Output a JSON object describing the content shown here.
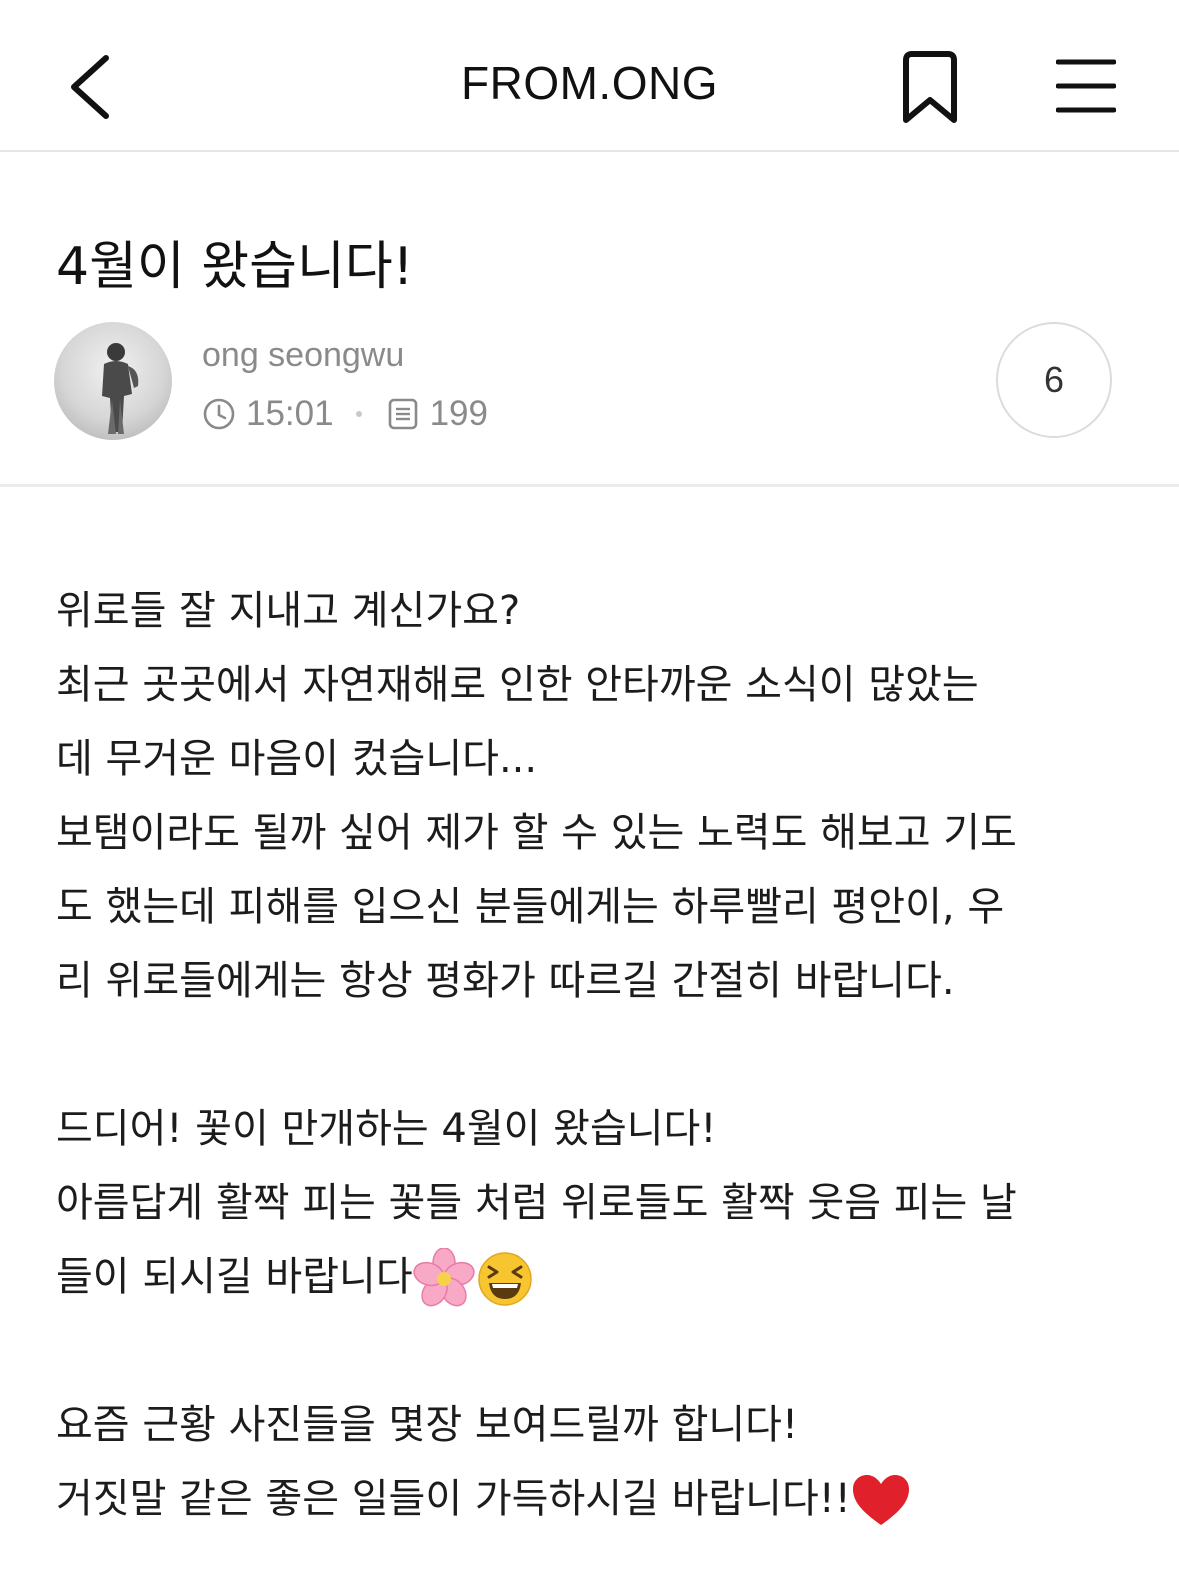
{
  "header": {
    "title": "FROM.ONG",
    "back_icon": "chevron-left-icon",
    "bookmark_icon": "bookmark-icon",
    "menu_icon": "hamburger-menu-icon"
  },
  "post": {
    "title": "4월이 왔습니다!",
    "author": "ong seongwu",
    "time": "15:01",
    "views": "199",
    "comment_count": "6"
  },
  "body": {
    "p1": [
      "위로들 잘 지내고 계신가요?",
      "최근 곳곳에서 자연재해로 인한 안타까운 소식이 많았는",
      "데 무거운 마음이 컸습니다...",
      "보탬이라도 될까 싶어 제가 할 수 있는 노력도 해보고 기도",
      "도 했는데 피해를 입으신 분들에게는 하루빨리 평안이, 우",
      "리 위로들에게는 항상 평화가 따르길 간절히 바랍니다."
    ],
    "p2": [
      "드디어! 꽃이 만개하는 4월이 왔습니다!",
      "아름답게 활짝 피는 꽃들 처럼 위로들도 활짝 웃음 피는 날",
      "들이 되시길 바랍니다"
    ],
    "p3": [
      "요즘 근황 사진들을 몇장 보여드릴까 합니다!",
      "거짓말 같은 좋은 일들이 가득하시길 바랍니다!!"
    ]
  },
  "colors": {
    "text": "#1c1c1c",
    "muted": "#8a8a8a",
    "divider": "#ebebeb",
    "heart": "#e0202a",
    "blossom": "#f7a9c6",
    "grin": "#f7c530"
  }
}
